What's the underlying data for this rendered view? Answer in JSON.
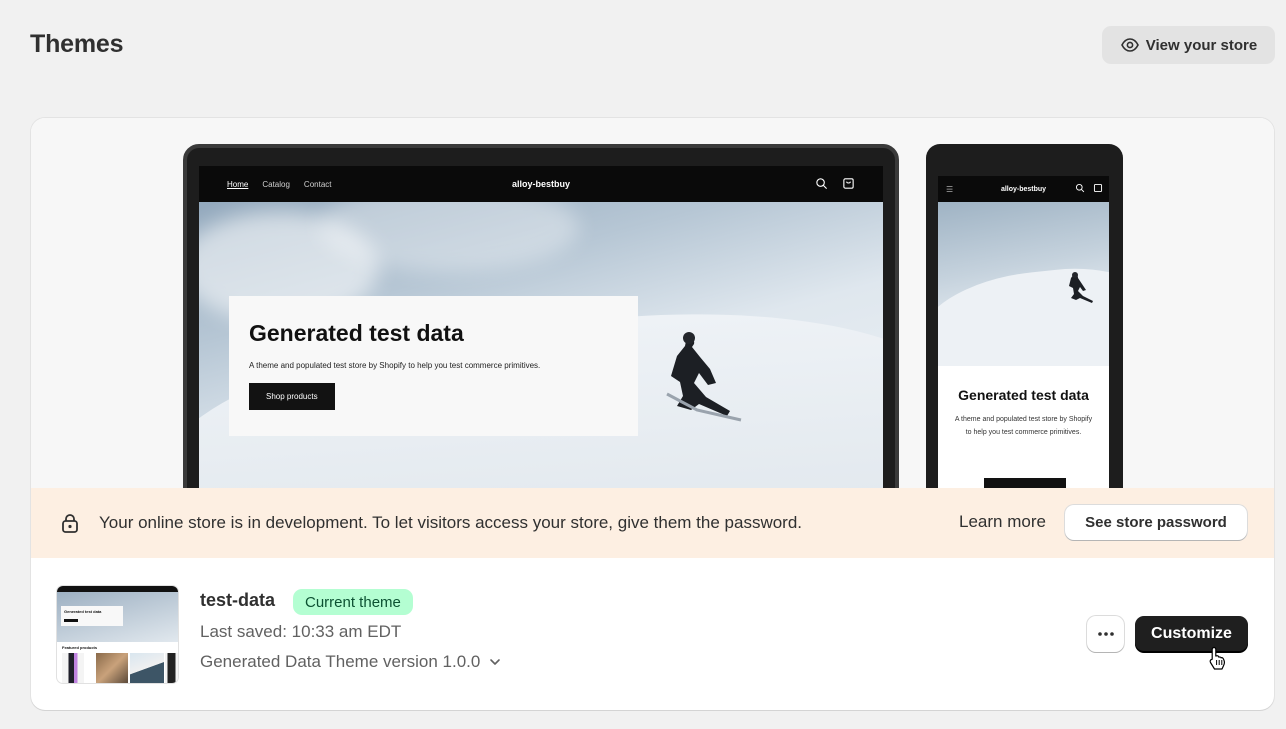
{
  "header": {
    "title": "Themes",
    "view_store_label": "View your store",
    "view_store_icon": "eye-icon"
  },
  "preview": {
    "desktop": {
      "nav_links": [
        "Home",
        "Catalog",
        "Contact"
      ],
      "brand": "alloy-bestbuy",
      "hero_title": "Generated test data",
      "hero_text": "A theme and populated test store by Shopify to help you test commerce primitives.",
      "hero_button": "Shop products"
    },
    "mobile": {
      "brand": "alloy-bestbuy",
      "hero_title": "Generated test data",
      "hero_text": "A theme and populated test store by Shopify to help you test commerce primitives."
    }
  },
  "banner": {
    "message": "Your online store is in development. To let visitors access your store, give them the password.",
    "learn_more": "Learn more",
    "password_button": "See store password",
    "background": "#fdefe2"
  },
  "theme": {
    "name": "test-data",
    "badge": "Current theme",
    "badge_color": "#b4fed2",
    "last_saved": "Last saved: 10:33 am EDT",
    "version": "Generated Data Theme version 1.0.0",
    "more_label": "•••",
    "customize_label": "Customize",
    "thumbnail": {
      "hero_title": "Generated test data",
      "section_label": "Featured products"
    }
  }
}
